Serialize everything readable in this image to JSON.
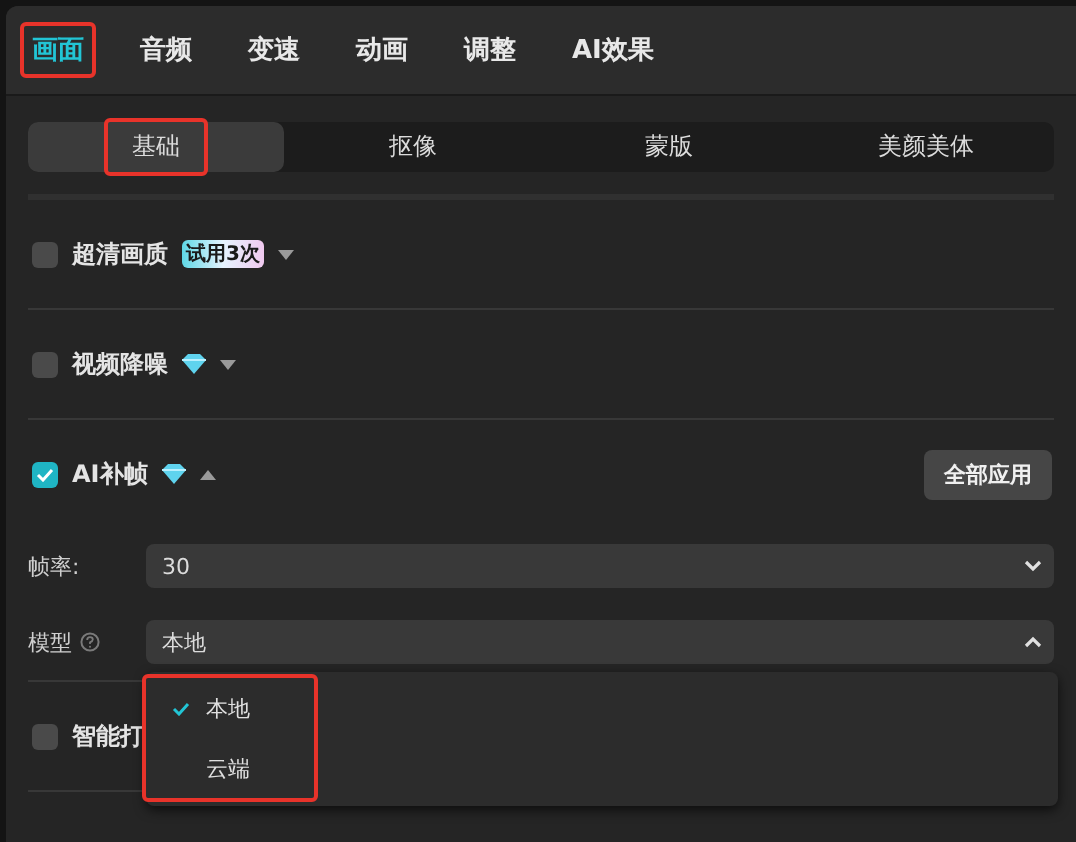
{
  "tabs": [
    {
      "label": "画面",
      "selected": true,
      "highlighted": true
    },
    {
      "label": "音频",
      "selected": false,
      "highlighted": false
    },
    {
      "label": "变速",
      "selected": false,
      "highlighted": false
    },
    {
      "label": "动画",
      "selected": false,
      "highlighted": false
    },
    {
      "label": "调整",
      "selected": false,
      "highlighted": false
    },
    {
      "label": "AI效果",
      "selected": false,
      "highlighted": false
    }
  ],
  "subtabs": [
    {
      "label": "基础",
      "selected": true,
      "highlighted": true
    },
    {
      "label": "抠像",
      "selected": false,
      "highlighted": false
    },
    {
      "label": "蒙版",
      "selected": false,
      "highlighted": false
    },
    {
      "label": "美颜美体",
      "selected": false,
      "highlighted": false
    }
  ],
  "options": [
    {
      "label": "超清画质",
      "checked": false,
      "badge": "试用3次",
      "premium": false,
      "expanded": false
    },
    {
      "label": "视频降噪",
      "checked": false,
      "premium": true,
      "expanded": false
    },
    {
      "label": "AI补帧",
      "checked": true,
      "premium": true,
      "expanded": true,
      "action": "全部应用",
      "fields": [
        {
          "label": "帧率:",
          "value": "30",
          "help": false,
          "open": false
        },
        {
          "label": "模型",
          "value": "本地",
          "help": true,
          "open": true
        }
      ]
    },
    {
      "label": "智能打",
      "checked": false,
      "premium": false
    }
  ],
  "dropdown": {
    "highlighted": true,
    "items": [
      {
        "label": "本地",
        "selected": true
      },
      {
        "label": "云端",
        "selected": false
      }
    ]
  }
}
